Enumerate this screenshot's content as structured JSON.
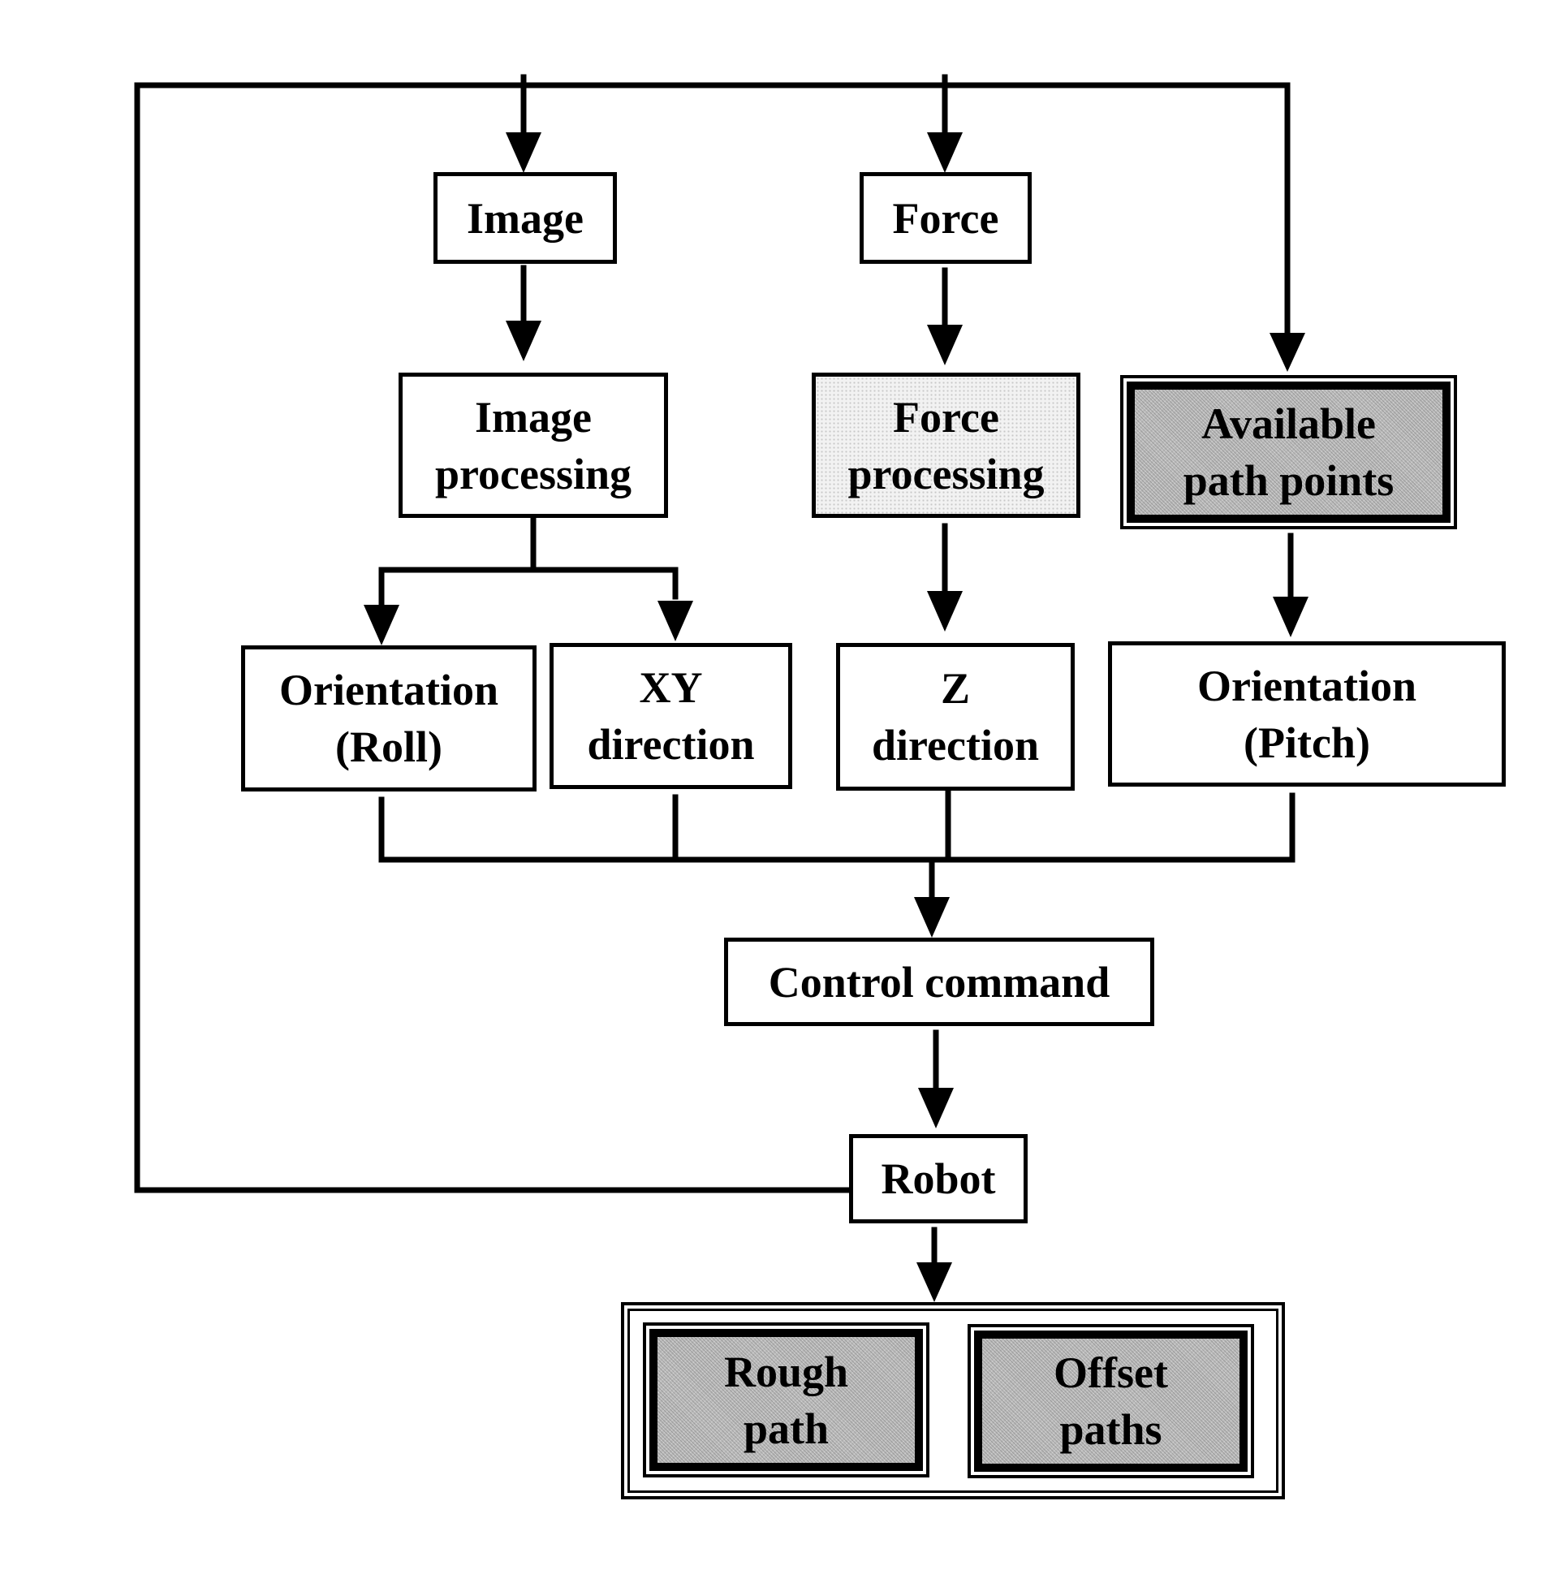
{
  "diagram": {
    "type": "flowchart",
    "nodes": {
      "image": "Image",
      "force": "Force",
      "image_processing": "Image\nprocessing",
      "force_processing": "Force\nprocessing",
      "available_path_points": "Available\npath points",
      "orientation_roll": "Orientation\n(Roll)",
      "xy_direction": "XY\ndirection",
      "z_direction": "Z\ndirection",
      "orientation_pitch": "Orientation\n(Pitch)",
      "control_command": "Control command",
      "robot": "Robot",
      "rough_path": "Rough\npath",
      "offset_paths": "Offset\npaths"
    },
    "edges": [
      [
        "robot",
        "image"
      ],
      [
        "robot",
        "force"
      ],
      [
        "robot",
        "available_path_points"
      ],
      [
        "image",
        "image_processing"
      ],
      [
        "force",
        "force_processing"
      ],
      [
        "image_processing",
        "orientation_roll"
      ],
      [
        "image_processing",
        "xy_direction"
      ],
      [
        "force_processing",
        "z_direction"
      ],
      [
        "available_path_points",
        "orientation_pitch"
      ],
      [
        "orientation_roll",
        "control_command"
      ],
      [
        "xy_direction",
        "control_command"
      ],
      [
        "z_direction",
        "control_command"
      ],
      [
        "orientation_pitch",
        "control_command"
      ],
      [
        "control_command",
        "robot"
      ],
      [
        "robot",
        "outputs"
      ]
    ],
    "outputs_group": [
      "rough_path",
      "offset_paths"
    ]
  }
}
